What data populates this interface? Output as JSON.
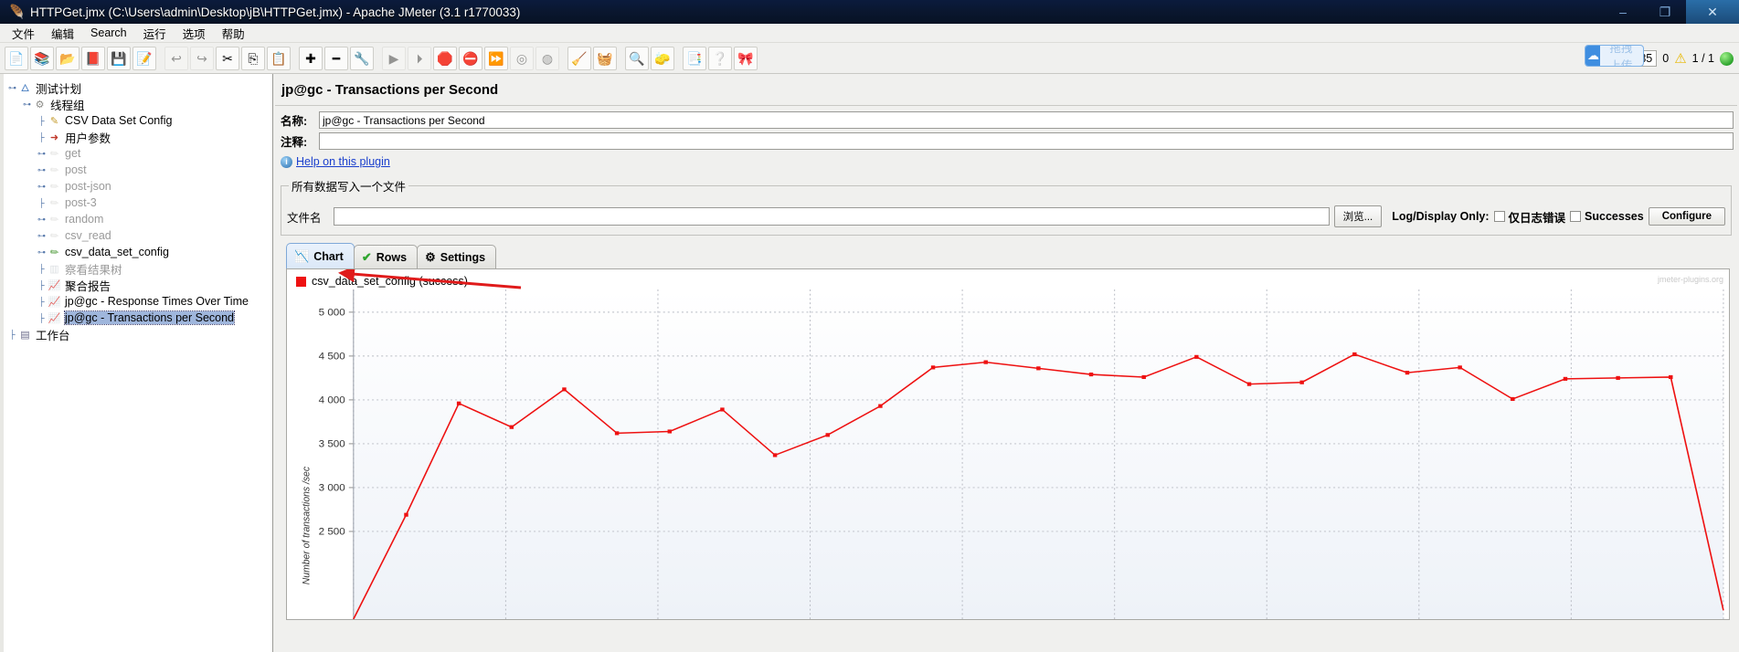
{
  "window": {
    "title": "HTTPGet.jmx (C:\\Users\\admin\\Desktop\\jB\\HTTPGet.jmx) - Apache JMeter (3.1 r1770033)",
    "app_icon": "jmeter-feather-icon",
    "controls": {
      "minimize": "–",
      "maximize": "❐",
      "close": "✕"
    }
  },
  "menu": {
    "items": [
      "文件",
      "编辑",
      "Search",
      "运行",
      "选项",
      "帮助"
    ]
  },
  "toolbar": {
    "buttons": [
      {
        "name": "new",
        "glyph": "📄",
        "disabled": false
      },
      {
        "name": "templates",
        "glyph": "📚",
        "disabled": false
      },
      {
        "name": "open",
        "glyph": "📂",
        "disabled": false
      },
      {
        "name": "close",
        "glyph": "📕",
        "disabled": false
      },
      {
        "name": "save",
        "glyph": "💾",
        "disabled": false
      },
      {
        "name": "save-as",
        "glyph": "📝",
        "disabled": false
      },
      {
        "name": "sep1",
        "glyph": "",
        "sep": true
      },
      {
        "name": "undo",
        "glyph": "↩",
        "disabled": true
      },
      {
        "name": "redo",
        "glyph": "↪",
        "disabled": true
      },
      {
        "name": "cut",
        "glyph": "✂",
        "disabled": false
      },
      {
        "name": "copy",
        "glyph": "⎘",
        "disabled": false
      },
      {
        "name": "paste",
        "glyph": "📋",
        "disabled": false
      },
      {
        "name": "sep2",
        "glyph": "",
        "sep": true
      },
      {
        "name": "expand-all",
        "glyph": "✚",
        "disabled": false
      },
      {
        "name": "collapse-all",
        "glyph": "━",
        "disabled": false
      },
      {
        "name": "toggle",
        "glyph": "🔧",
        "disabled": false
      },
      {
        "name": "sep3",
        "glyph": "",
        "sep": true
      },
      {
        "name": "start",
        "glyph": "▶",
        "disabled": true
      },
      {
        "name": "start-no-pauses",
        "glyph": "⏵",
        "disabled": true
      },
      {
        "name": "stop",
        "glyph": "🛑",
        "disabled": false
      },
      {
        "name": "shutdown",
        "glyph": "⛔",
        "disabled": false
      },
      {
        "name": "start-remote-all",
        "glyph": "⏩",
        "disabled": false
      },
      {
        "name": "stop-remote-all",
        "glyph": "◎",
        "disabled": true
      },
      {
        "name": "shutdown-remote-all",
        "glyph": "◍",
        "disabled": true
      },
      {
        "name": "sep4",
        "glyph": "",
        "sep": true
      },
      {
        "name": "clear",
        "glyph": "🧹",
        "disabled": false
      },
      {
        "name": "clear-all",
        "glyph": "🧺",
        "disabled": false
      },
      {
        "name": "sep5",
        "glyph": "",
        "sep": true
      },
      {
        "name": "search",
        "glyph": "🔍",
        "disabled": false
      },
      {
        "name": "reset-search",
        "glyph": "🧽",
        "disabled": false
      },
      {
        "name": "sep6",
        "glyph": "",
        "sep": true
      },
      {
        "name": "function-helper",
        "glyph": "📑",
        "disabled": false
      },
      {
        "name": "help",
        "glyph": "❔",
        "disabled": false
      },
      {
        "name": "about",
        "glyph": "🎀",
        "disabled": false
      }
    ],
    "upload_widget": {
      "label": "拖拽上传",
      "icon": "cloud-upload-icon"
    },
    "status": {
      "elapsed": "00:00:35",
      "warning_count": "0",
      "warning_icon": "warning-triangle-icon",
      "threads": "1 / 1",
      "running_indicator": "green-circle-icon"
    }
  },
  "tree": {
    "nodes": [
      {
        "label": "测试计划",
        "indent": 0,
        "icon": "test-plan-icon",
        "icon_class": "ic-plan",
        "handle": "expanded",
        "dim": false,
        "selected": false
      },
      {
        "label": "线程组",
        "indent": 1,
        "icon": "thread-group-icon",
        "icon_class": "ic-gear",
        "handle": "expanded",
        "dim": false,
        "selected": false
      },
      {
        "label": "CSV Data Set Config",
        "indent": 2,
        "icon": "csv-config-icon",
        "icon_class": "ic-csv",
        "handle": "none",
        "dim": false,
        "selected": false
      },
      {
        "label": "用户参数",
        "indent": 2,
        "icon": "user-params-icon",
        "icon_class": "ic-user",
        "handle": "none",
        "dim": false,
        "selected": false
      },
      {
        "label": "get",
        "indent": 2,
        "icon": "http-request-icon",
        "icon_class": "ic-http",
        "handle": "collapsed",
        "dim": true,
        "selected": false
      },
      {
        "label": "post",
        "indent": 2,
        "icon": "http-request-icon",
        "icon_class": "ic-http",
        "handle": "collapsed",
        "dim": true,
        "selected": false
      },
      {
        "label": "post-json",
        "indent": 2,
        "icon": "http-request-icon",
        "icon_class": "ic-http",
        "handle": "collapsed",
        "dim": true,
        "selected": false
      },
      {
        "label": "post-3",
        "indent": 2,
        "icon": "http-request-icon",
        "icon_class": "ic-http",
        "handle": "none",
        "dim": true,
        "selected": false
      },
      {
        "label": "random",
        "indent": 2,
        "icon": "http-request-icon",
        "icon_class": "ic-http",
        "handle": "collapsed",
        "dim": true,
        "selected": false
      },
      {
        "label": "csv_read",
        "indent": 2,
        "icon": "http-request-icon",
        "icon_class": "ic-http",
        "handle": "collapsed",
        "dim": true,
        "selected": false
      },
      {
        "label": "csv_data_set_config",
        "indent": 2,
        "icon": "http-request-icon",
        "icon_class": "ic-http-on",
        "handle": "collapsed",
        "dim": false,
        "selected": false
      },
      {
        "label": "察看结果树",
        "indent": 2,
        "icon": "view-results-tree-icon",
        "icon_class": "ic-bar",
        "handle": "none",
        "dim": true,
        "selected": false
      },
      {
        "label": "聚合报告",
        "indent": 2,
        "icon": "aggregate-report-icon",
        "icon_class": "ic-chart",
        "handle": "none",
        "dim": false,
        "selected": false
      },
      {
        "label": "jp@gc - Response Times Over Time",
        "indent": 2,
        "icon": "response-times-icon",
        "icon_class": "ic-chart",
        "handle": "none",
        "dim": false,
        "selected": false
      },
      {
        "label": "jp@gc - Transactions per Second",
        "indent": 2,
        "icon": "tps-chart-icon",
        "icon_class": "ic-chart",
        "handle": "none",
        "dim": false,
        "selected": true
      },
      {
        "label": "工作台",
        "indent": 0,
        "icon": "workbench-icon",
        "icon_class": "ic-bench",
        "handle": "none",
        "dim": false,
        "selected": false
      }
    ]
  },
  "panel": {
    "title": "jp@gc - Transactions per Second",
    "name_label": "名称:",
    "name_value": "jp@gc - Transactions per Second",
    "comment_label": "注释:",
    "comment_value": "",
    "help_link": "Help on this plugin",
    "help_icon": "info-icon"
  },
  "file_group": {
    "legend": "所有数据写入一个文件",
    "filename_label": "文件名",
    "filename_value": "",
    "browse_button": "浏览...",
    "log_display_label": "Log/Display Only:",
    "errors_checkbox": {
      "label": "仅日志错误",
      "checked": false
    },
    "successes_checkbox": {
      "label": "Successes",
      "checked": false
    },
    "configure_button": "Configure"
  },
  "tabs": [
    {
      "label": "Chart",
      "icon": "chart-icon",
      "active": true
    },
    {
      "label": "Rows",
      "icon": "checkmark-icon",
      "active": false
    },
    {
      "label": "Settings",
      "icon": "gear-icon",
      "active": false
    }
  ],
  "chart_panel": {
    "legend_label": "csv_data_set_config (success)",
    "legend_color": "#ee1111",
    "watermark": "jmeter-plugins.org"
  },
  "annotation": {
    "arrow_color": "#e01b1b",
    "name": "red-pointer-arrow"
  },
  "chart_data": {
    "type": "line",
    "title": "",
    "xlabel": "",
    "ylabel": "Number of transactions /sec",
    "ylim": [
      1500,
      5200
    ],
    "yticks": [
      5000,
      4500,
      4000,
      3500,
      3000,
      2500
    ],
    "ytick_labels": [
      "5 000",
      "4 500",
      "4 000",
      "3 500",
      "3 000",
      "2 500"
    ],
    "grid": true,
    "legend_position": "top-left",
    "series": [
      {
        "name": "csv_data_set_config (success)",
        "color": "#ee1111",
        "x": [
          0,
          1,
          2,
          3,
          4,
          5,
          6,
          7,
          8,
          9,
          10,
          11,
          12,
          13,
          14,
          15,
          16,
          17,
          18,
          19,
          20,
          21,
          22,
          23,
          24,
          25,
          26
        ],
        "values": [
          1500,
          2690,
          3960,
          3690,
          4120,
          3620,
          3640,
          3890,
          3370,
          3600,
          3930,
          4370,
          4430,
          4360,
          4290,
          4260,
          4490,
          4180,
          4200,
          4520,
          4310,
          4370,
          4010,
          4240,
          4250,
          4260,
          1600
        ]
      }
    ]
  }
}
